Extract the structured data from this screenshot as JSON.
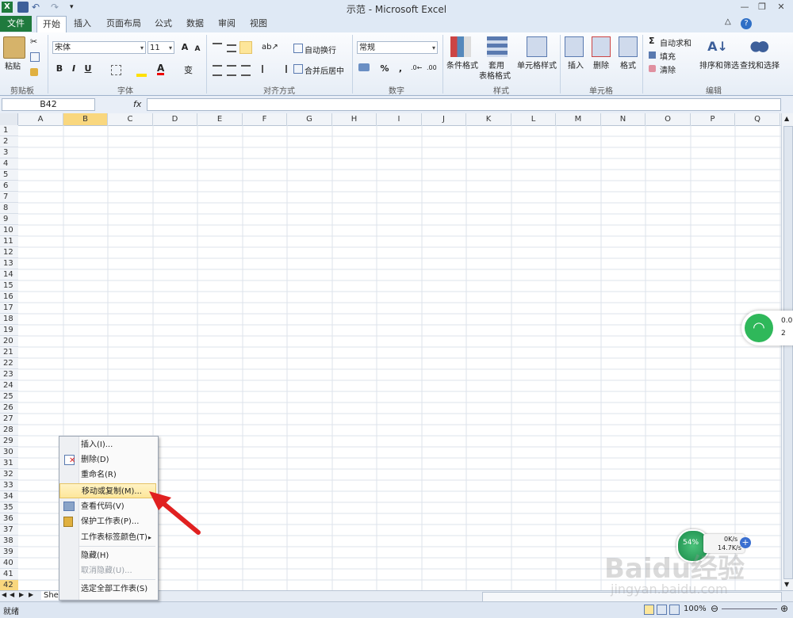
{
  "title": "示范 - Microsoft Excel",
  "tabs": [
    "文件",
    "开始",
    "插入",
    "页面布局",
    "公式",
    "数据",
    "审阅",
    "视图"
  ],
  "ribbon": {
    "clipboard": {
      "paste": "粘贴",
      "group": "剪贴板"
    },
    "font": {
      "name": "宋体",
      "size": "11",
      "group": "字体",
      "bold": "B",
      "italic": "I",
      "underline": "U",
      "grow": "A",
      "shrink": "A",
      "wen": "变"
    },
    "align": {
      "wrap": "自动换行",
      "merge": "合并后居中",
      "group": "对齐方式"
    },
    "number": {
      "format": "常规",
      "percent": "%",
      "comma": ",",
      "group": "数字"
    },
    "styles": {
      "cond": "条件格式",
      "table": "套用\n表格格式",
      "cell": "单元格样式",
      "table1": "套用",
      "table2": "表格格式",
      "group": "样式"
    },
    "cells": {
      "insert": "插入",
      "delete": "删除",
      "format": "格式",
      "group": "单元格"
    },
    "editing": {
      "autosum": "自动求和",
      "fill": "填充",
      "clear": "清除",
      "sort": "排序和筛选",
      "find": "查找和选择",
      "group": "编辑",
      "sigma": "Σ"
    }
  },
  "namebox": "B42",
  "fx": "fx",
  "columns": [
    "A",
    "B",
    "C",
    "D",
    "E",
    "F",
    "G",
    "H",
    "I",
    "J",
    "K",
    "L",
    "M",
    "N",
    "O",
    "P",
    "Q"
  ],
  "rows": [
    "1",
    "2",
    "3",
    "4",
    "5",
    "6",
    "7",
    "8",
    "9",
    "10",
    "11",
    "12",
    "13",
    "14",
    "15",
    "16",
    "17",
    "18",
    "19",
    "20",
    "21",
    "22",
    "23",
    "24",
    "25",
    "26",
    "27",
    "28",
    "29",
    "30",
    "31",
    "32",
    "33",
    "34",
    "35",
    "36",
    "37",
    "38",
    "39",
    "40",
    "41",
    "42"
  ],
  "context_menu": [
    {
      "label": "插入(I)...",
      "icon": "",
      "disabled": false
    },
    {
      "label": "删除(D)",
      "icon": "delete-sheet-icon",
      "disabled": false
    },
    {
      "label": "重命名(R)",
      "icon": "",
      "disabled": false
    },
    {
      "label": "移动或复制(M)...",
      "icon": "",
      "disabled": false,
      "highlighted": true
    },
    {
      "label": "查看代码(V)",
      "icon": "view-code-icon",
      "disabled": false
    },
    {
      "label": "保护工作表(P)...",
      "icon": "protect-sheet-icon",
      "disabled": false
    },
    {
      "label": "工作表标签颜色(T)",
      "icon": "",
      "disabled": false,
      "submenu": true
    },
    {
      "label": "隐藏(H)",
      "icon": "",
      "disabled": false
    },
    {
      "label": "取消隐藏(U)...",
      "icon": "",
      "disabled": true
    },
    {
      "label": "选定全部工作表(S)",
      "icon": "",
      "disabled": false
    }
  ],
  "sheet_tab": "Shee",
  "status": "就绪",
  "zoom": "100%",
  "widgets": {
    "wifi_top": "0.0",
    "wifi_bottom": "2",
    "speed_pct": "54%",
    "upload": "0K/s",
    "download": "14.7K/s"
  },
  "watermark": {
    "brand": "Baidu经验",
    "url": "jingyan.baidu.com"
  },
  "colors": {
    "file_tab": "#1f7a3d",
    "highlight": "#fde69a",
    "selected_col": "#f9d77e",
    "arrow": "#e02020"
  }
}
